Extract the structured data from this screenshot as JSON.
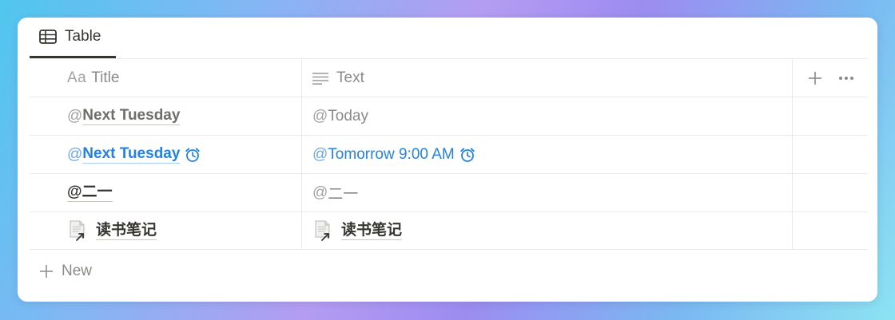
{
  "view": {
    "tab_label": "Table",
    "tab_icon": "table-icon"
  },
  "columns": [
    {
      "label": "Title",
      "type_glyph": "Aa",
      "icon": "text-type-aa-icon"
    },
    {
      "label": "Text",
      "icon": "text-lines-icon"
    }
  ],
  "header_actions": {
    "add_icon": "plus-icon",
    "more_icon": "more-dots-icon"
  },
  "rows": [
    {
      "title": {
        "at": "@",
        "text": "Next Tuesday",
        "style": "date-mention"
      },
      "text": {
        "at": "@",
        "text": "Today",
        "style": "date-mention"
      }
    },
    {
      "title": {
        "at": "@",
        "text": "Next Tuesday",
        "style": "reminder-mention",
        "icon": "alarm-clock-icon"
      },
      "text": {
        "at": "@",
        "text": "Tomorrow 9:00 AM",
        "style": "reminder-mention",
        "icon": "alarm-clock-icon"
      }
    },
    {
      "title": {
        "at": "@",
        "text": "二一",
        "style": "user-mention"
      },
      "text": {
        "at": "@",
        "text": "二一",
        "style": "user-mention"
      }
    },
    {
      "title": {
        "text": "读书笔记",
        "style": "page-link",
        "icon": "page-link-icon"
      },
      "text": {
        "text": "读书笔记",
        "style": "page-link",
        "icon": "page-link-icon"
      }
    }
  ],
  "new_row_label": "New",
  "colors": {
    "accent_blue": "#2383e2",
    "text_primary": "#37352f",
    "text_secondary": "#8b8a86",
    "divider": "#e9e9e7"
  }
}
